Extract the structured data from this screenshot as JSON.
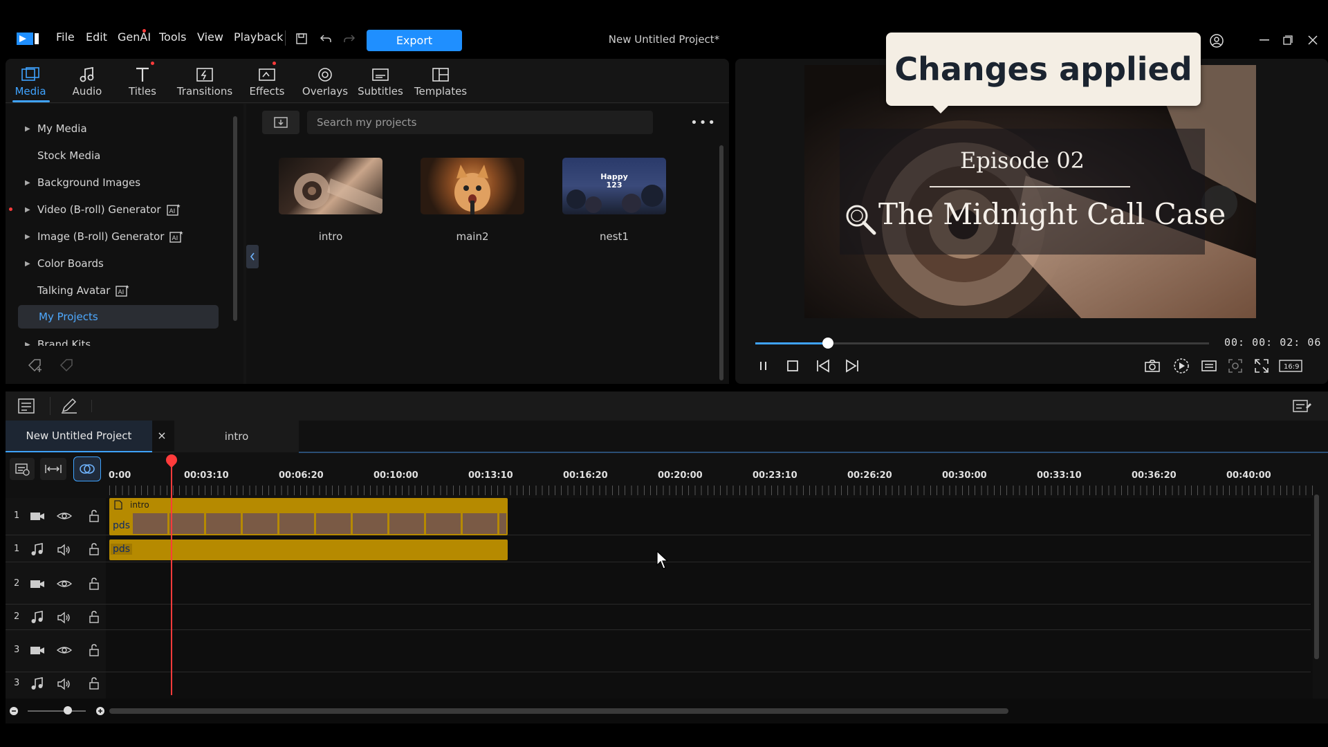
{
  "menu": {
    "file": "File",
    "edit": "Edit",
    "genai": "GenAI",
    "tools": "Tools",
    "view": "View",
    "playback": "Playback"
  },
  "export_label": "Export",
  "project_title": "New Untitled Project*",
  "toast": "Changes applied",
  "tabs": [
    {
      "label": "Media",
      "icon": "media-icon",
      "active": true
    },
    {
      "label": "Audio",
      "icon": "music-note-icon"
    },
    {
      "label": "Titles",
      "icon": "text-icon"
    },
    {
      "label": "Transitions",
      "icon": "transitions-icon"
    },
    {
      "label": "Effects",
      "icon": "effects-icon"
    },
    {
      "label": "Overlays",
      "icon": "overlays-icon"
    },
    {
      "label": "Subtitles",
      "icon": "subtitles-icon"
    },
    {
      "label": "Templates",
      "icon": "templates-icon"
    }
  ],
  "tree": {
    "items": [
      "My Media",
      "Stock Media",
      "Background Images",
      "Video (B-roll) Generator",
      "Image (B-roll) Generator",
      "Color Boards",
      "Talking Avatar",
      "My Projects",
      "Brand Kits"
    ]
  },
  "search": {
    "placeholder": "Search my projects"
  },
  "media": [
    {
      "name": "intro"
    },
    {
      "name": "main2"
    },
    {
      "name": "nest1"
    }
  ],
  "nest1_overlay": "Happy\n123",
  "preview": {
    "episode": "Episode 02",
    "title": "The Midnight Call Case",
    "timecode": "00: 00: 02: 06",
    "progress": 0.16
  },
  "timeline": {
    "tab_project": "New Untitled Project",
    "tab_close": "×",
    "tab_intro": "intro",
    "ticks": [
      "0:00",
      "00:03:10",
      "00:06:20",
      "00:10:00",
      "00:13:10",
      "00:16:20",
      "00:20:00",
      "00:23:10",
      "00:26:20",
      "00:30:00",
      "00:33:10",
      "00:36:20",
      "00:40:00"
    ],
    "tracks": [
      "1",
      "1",
      "2",
      "2",
      "3",
      "3"
    ],
    "clip_name": "intro",
    "clip_tag": "pds"
  },
  "colors": {
    "accent": "#1f8fff",
    "clip": "#b68a00",
    "playhead": "#ff3b3b"
  }
}
